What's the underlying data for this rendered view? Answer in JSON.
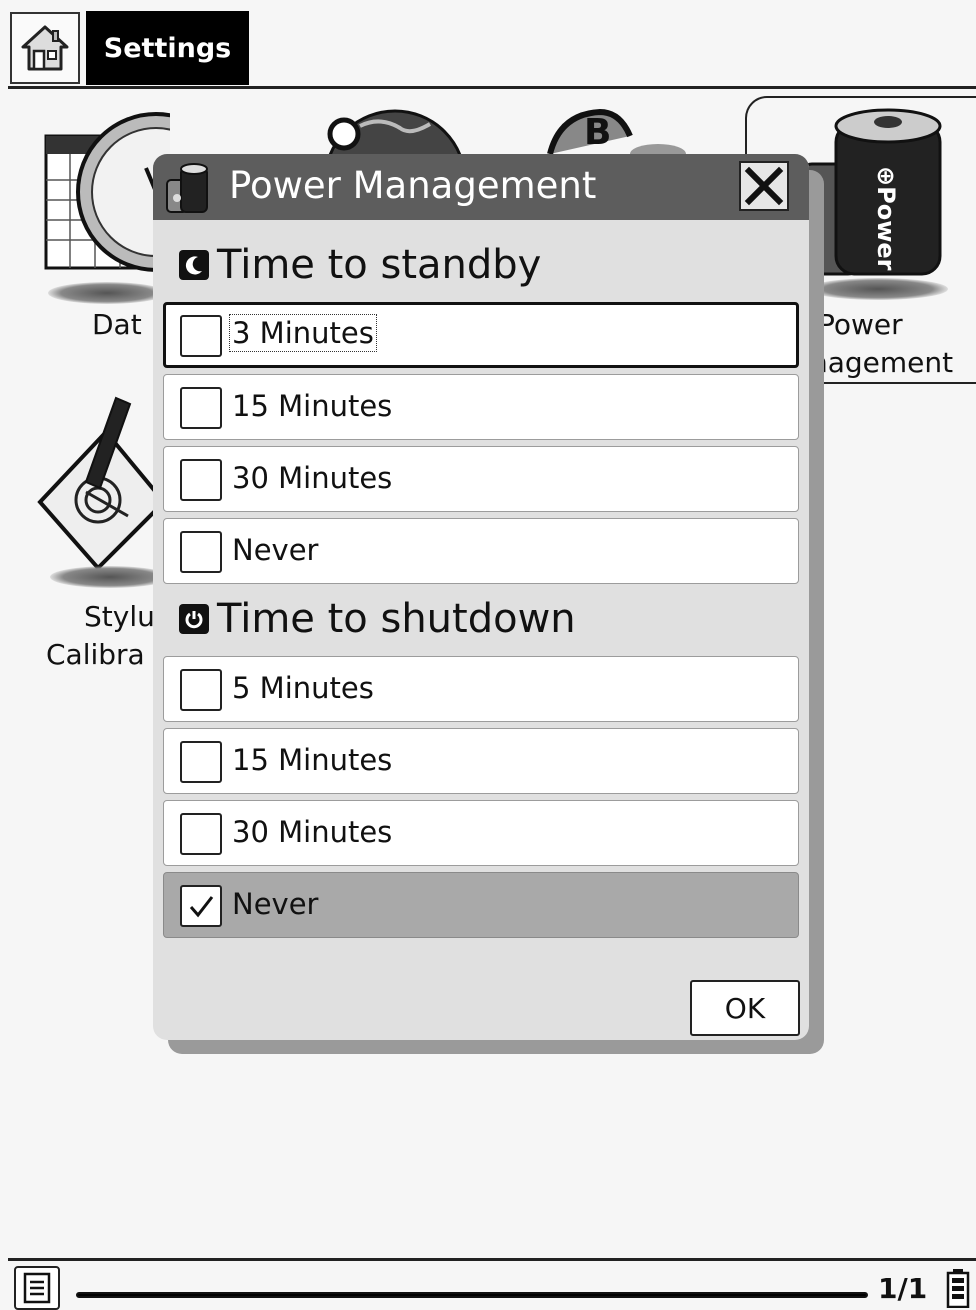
{
  "topbar": {
    "home_icon": "home-icon",
    "title": "Settings"
  },
  "background_items": [
    {
      "label": "Dat",
      "icon": "calendar-clock-icon"
    },
    {
      "label": "",
      "icon": "globe-icon"
    },
    {
      "label": "",
      "icon": "bookmark-b-icon"
    },
    {
      "label_line1": "Power",
      "label_line2": "nagement",
      "icon": "power-battery-icon"
    },
    {
      "label_line1": "Stylu",
      "label_line2": "Calibra",
      "icon": "stylus-pen-icon"
    }
  ],
  "dialog": {
    "title": "Power Management",
    "standby": {
      "heading": "Time to standby",
      "options": [
        {
          "label": "3 Minutes",
          "checked": false,
          "focused": true
        },
        {
          "label": "15 Minutes",
          "checked": false
        },
        {
          "label": "30 Minutes",
          "checked": false
        },
        {
          "label": "Never",
          "checked": false
        }
      ]
    },
    "shutdown": {
      "heading": "Time to shutdown",
      "options": [
        {
          "label": "5 Minutes",
          "checked": false
        },
        {
          "label": "15 Minutes",
          "checked": false
        },
        {
          "label": "30 Minutes",
          "checked": false
        },
        {
          "label": "Never",
          "checked": true
        }
      ]
    },
    "ok_label": "OK"
  },
  "bottombar": {
    "page": "1/1",
    "progress": 1.0
  }
}
